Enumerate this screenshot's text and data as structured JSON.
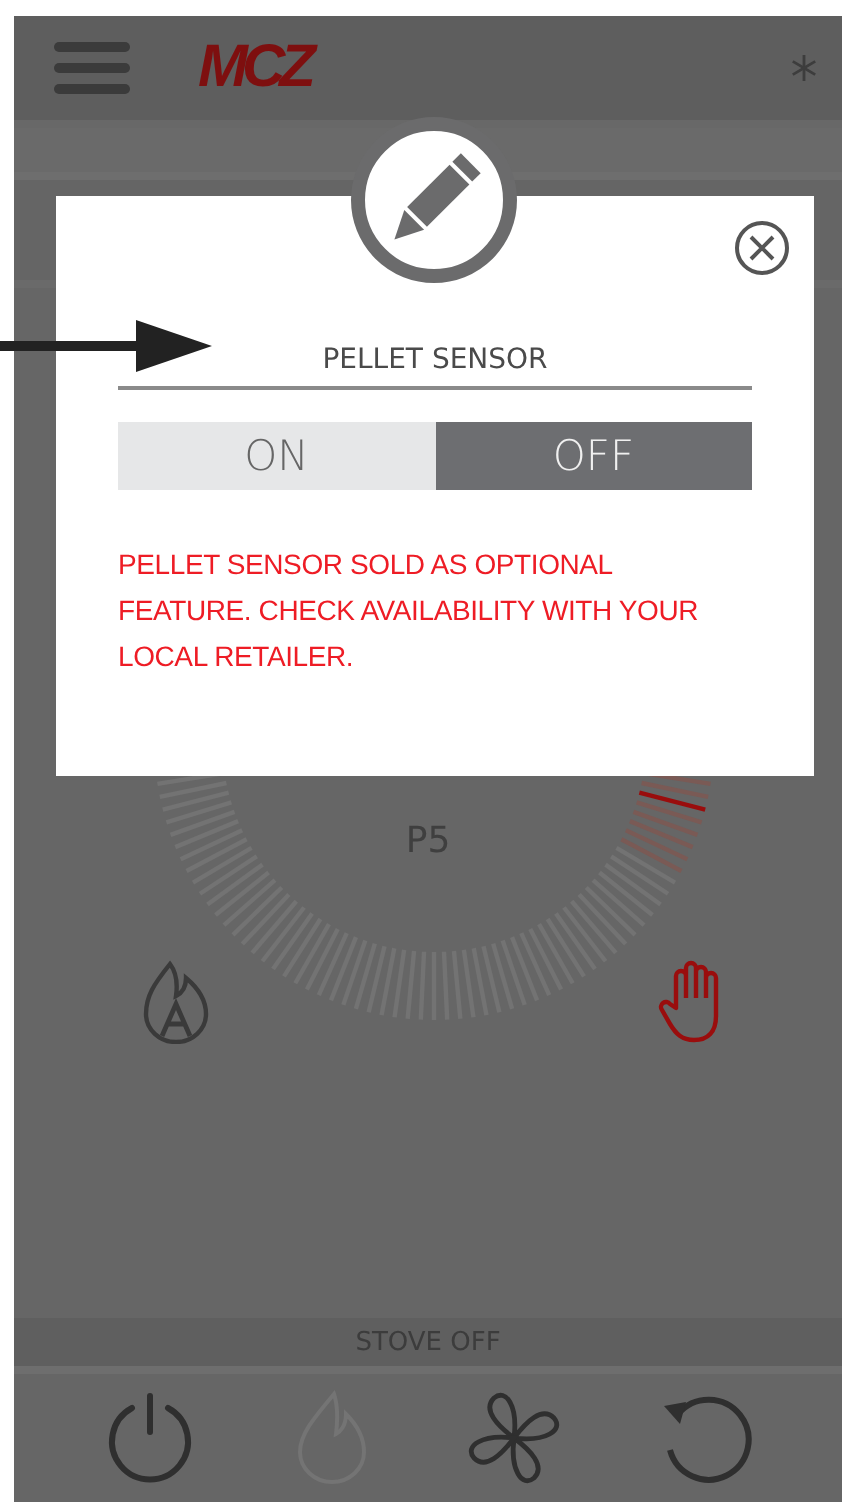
{
  "header": {
    "logo": "MCZ"
  },
  "gauge": {
    "power_level": "P5"
  },
  "status_bar": {
    "text": "STOVE OFF"
  },
  "bottom_bar": [
    {
      "kind": "power",
      "disabled": false
    },
    {
      "kind": "flame",
      "disabled": true
    },
    {
      "kind": "fan",
      "disabled": false
    },
    {
      "kind": "reset",
      "disabled": false
    }
  ],
  "dialog": {
    "title": "PELLET SENSOR",
    "options": [
      {
        "label": "ON",
        "selected": false
      },
      {
        "label": "OFF",
        "selected": true
      }
    ],
    "warning": "PELLET SENSOR SOLD AS OPTIONAL FEATURE. CHECK AVAILABILITY WITH YOUR LOCAL RETAILER."
  }
}
